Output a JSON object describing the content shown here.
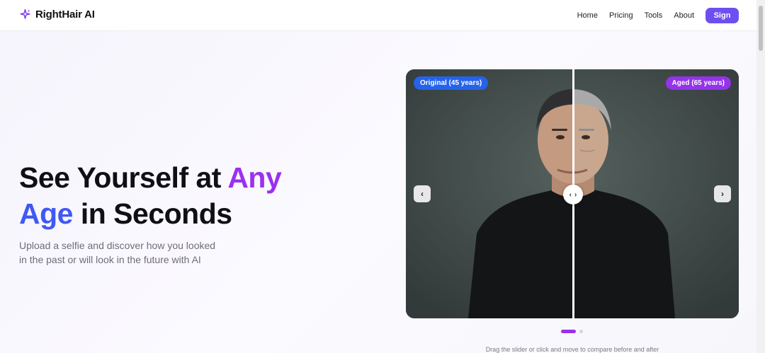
{
  "brand": {
    "name": "RightHair AI",
    "icon": "sparkle-icon",
    "accent": "#7c3aed"
  },
  "nav": {
    "links": [
      "Home",
      "Pricing",
      "Tools",
      "About"
    ],
    "signin_label": "Sign In",
    "signin_color": "#6d4ef0"
  },
  "hero": {
    "headline_part1": "See Yourself at ",
    "headline_accent1": "Any",
    "headline_accent2": "Age",
    "headline_part2": " in Seconds",
    "subtext": "Upload a selfie and discover how you looked in the past or will look in the future with AI",
    "gradient_start": "#3b63f5",
    "gradient_end": "#a02ff0"
  },
  "comparison": {
    "left_label": "Original (45 years)",
    "right_label": "Aged (65 years)",
    "left_badge_color": "#2563eb",
    "right_badge_color": "#9333ea",
    "prev_icon": "chevron-left-icon",
    "next_icon": "chevron-right-icon",
    "slider_position": 0.5,
    "caption": "Drag the slider or click and move to compare before and after"
  },
  "carousel": {
    "total_slides": 2,
    "active_slide": 1
  }
}
